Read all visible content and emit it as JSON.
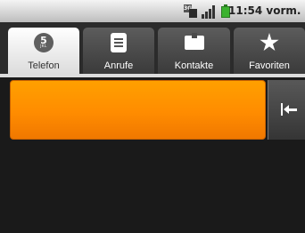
{
  "status_bar": {
    "time": "11:54 vorm.",
    "icons": [
      "3g-data-icon",
      "signal-strength-icon",
      "battery-icon"
    ],
    "network_label": "3G"
  },
  "tabs": [
    {
      "label": "Telefon",
      "icon": "dialpad-icon",
      "selected": true,
      "icon_digit": "5",
      "icon_letters": "JKL"
    },
    {
      "label": "Anrufe",
      "icon": "call-log-icon",
      "selected": false
    },
    {
      "label": "Kontakte",
      "icon": "contacts-icon",
      "selected": false
    },
    {
      "label": "Favoriten",
      "icon": "star-icon",
      "selected": false
    }
  ],
  "dialer": {
    "digits_value": "",
    "backspace_icon": "backspace-arrow-icon"
  },
  "colors": {
    "digits_field": "#ff8c00",
    "tab_selected": "#ffffff",
    "tab_unselected": "#4a4a4a",
    "background": "#1a1a1a",
    "battery": "#3bb22f"
  }
}
